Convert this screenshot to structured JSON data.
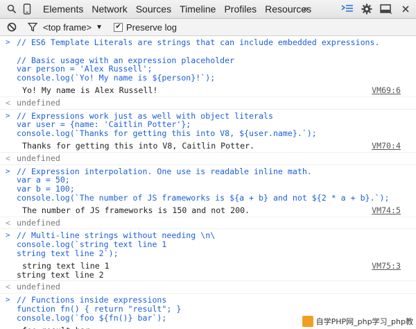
{
  "tabbar": {
    "tabs": [
      "Elements",
      "Network",
      "Sources",
      "Timeline",
      "Profiles",
      "Resources"
    ],
    "overflow": "»"
  },
  "toolbar": {
    "frame": "<top frame>",
    "frame_arrow": "▼",
    "preserve_checked": true,
    "preserve_label": "Preserve log"
  },
  "console": {
    "prompt": ">",
    "result_marker": "<",
    "entries": [
      {
        "input": [
          "// ES6 Template Literals are strings that can include embedded expressions.",
          "",
          "// Basic usage with an expression placeholder",
          "var person = 'Alex Russell';",
          "console.log(`Yo! My name is ${person}!`);"
        ],
        "output": [
          "Yo! My name is Alex Russell!"
        ],
        "source": "VM69:6",
        "result": "undefined"
      },
      {
        "input": [
          "// Expressions work just as well with object literals",
          "var user = {name: 'Caitlin Potter'};",
          "console.log(`Thanks for getting this into V8, ${user.name}.`);"
        ],
        "output": [
          "Thanks for getting this into V8, Caitlin Potter."
        ],
        "source": "VM70:4",
        "result": "undefined"
      },
      {
        "input": [
          "// Expression interpolation. One use is readable inline math.",
          "var a = 50;",
          "var b = 100;",
          "console.log(`The number of JS frameworks is ${a + b} and not ${2 * a + b}.`);"
        ],
        "output": [
          "The number of JS frameworks is 150 and not 200."
        ],
        "source": "VM74:5",
        "result": "undefined"
      },
      {
        "input": [
          "// Multi-line strings without needing \\n\\",
          "console.log(`string text line 1",
          "string text line 2`);"
        ],
        "output": [
          "string text line 1",
          "string text line 2"
        ],
        "source": "VM75:3",
        "result": "undefined"
      },
      {
        "input": [
          "// Functions inside expressions",
          "function fn() { return \"result\"; }",
          "console.log(`foo ${fn()} bar`);"
        ],
        "output": [
          "foo result bar"
        ],
        "source": "",
        "result": ""
      }
    ]
  },
  "watermark": {
    "text": "自学PHP网_php学习_php教"
  },
  "colors": {
    "code": "#1c5fd6",
    "accent_icon": "#2b73e0"
  }
}
